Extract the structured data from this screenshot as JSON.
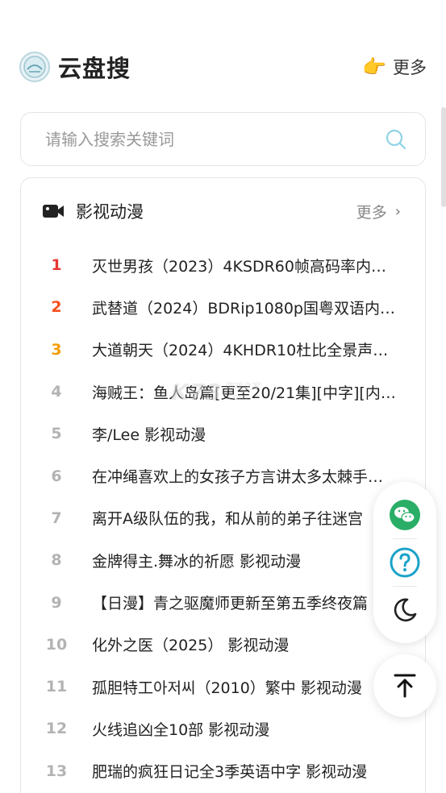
{
  "header": {
    "brand": "云盘搜",
    "more_label": "更多",
    "more_icon": "pointing-hand-icon"
  },
  "search": {
    "placeholder": "请输入搜索关键词",
    "value": ""
  },
  "section": {
    "title": "影视动漫",
    "more_label": "更多",
    "chevron": "›",
    "items": [
      {
        "rank": "1",
        "text": "灭世男孩（2023）4KSDR60帧高码率内…"
      },
      {
        "rank": "2",
        "text": "武替道（2024）BDRip1080p国粤双语内…"
      },
      {
        "rank": "3",
        "text": "大道朝天（2024）4KHDR10杜比全景声…"
      },
      {
        "rank": "4",
        "text": "海贼王：鱼人岛篇[更至20/21集][中字][内…"
      },
      {
        "rank": "5",
        "text": "李/Lee 影视动漫"
      },
      {
        "rank": "6",
        "text": "在冲绳喜欢上的女孩子方言讲太多太棘手…"
      },
      {
        "rank": "7",
        "text": "离开A级队伍的我，和从前的弟子往迷宫"
      },
      {
        "rank": "8",
        "text": "金牌得主.舞冰的祈愿 影视动漫"
      },
      {
        "rank": "9",
        "text": "【日漫】青之驱魔师更新至第五季终夜篇"
      },
      {
        "rank": "10",
        "text": "化外之医（2025） 影视动漫"
      },
      {
        "rank": "11",
        "text": "孤胆特工아저씨（2010）繁中 影视动漫"
      },
      {
        "rank": "12",
        "text": "火线追凶全10部 影视动漫"
      },
      {
        "rank": "13",
        "text": "肥瑞的疯狂日记全3季英语中字 影视动漫"
      }
    ]
  },
  "floating": {
    "wechat_icon": "wechat-icon",
    "help_icon": "help-icon",
    "theme_icon": "moon-icon",
    "top_icon": "back-to-top-icon"
  },
  "watermark": {
    "main": "K73",
    "sub1": "游戏之家",
    "sub2": ".com"
  },
  "colors": {
    "rank1": "#e53935",
    "rank2": "#f4511e",
    "rank3": "#f59e0b",
    "wechat": "#2aae67",
    "help": "#1aa3c8"
  }
}
